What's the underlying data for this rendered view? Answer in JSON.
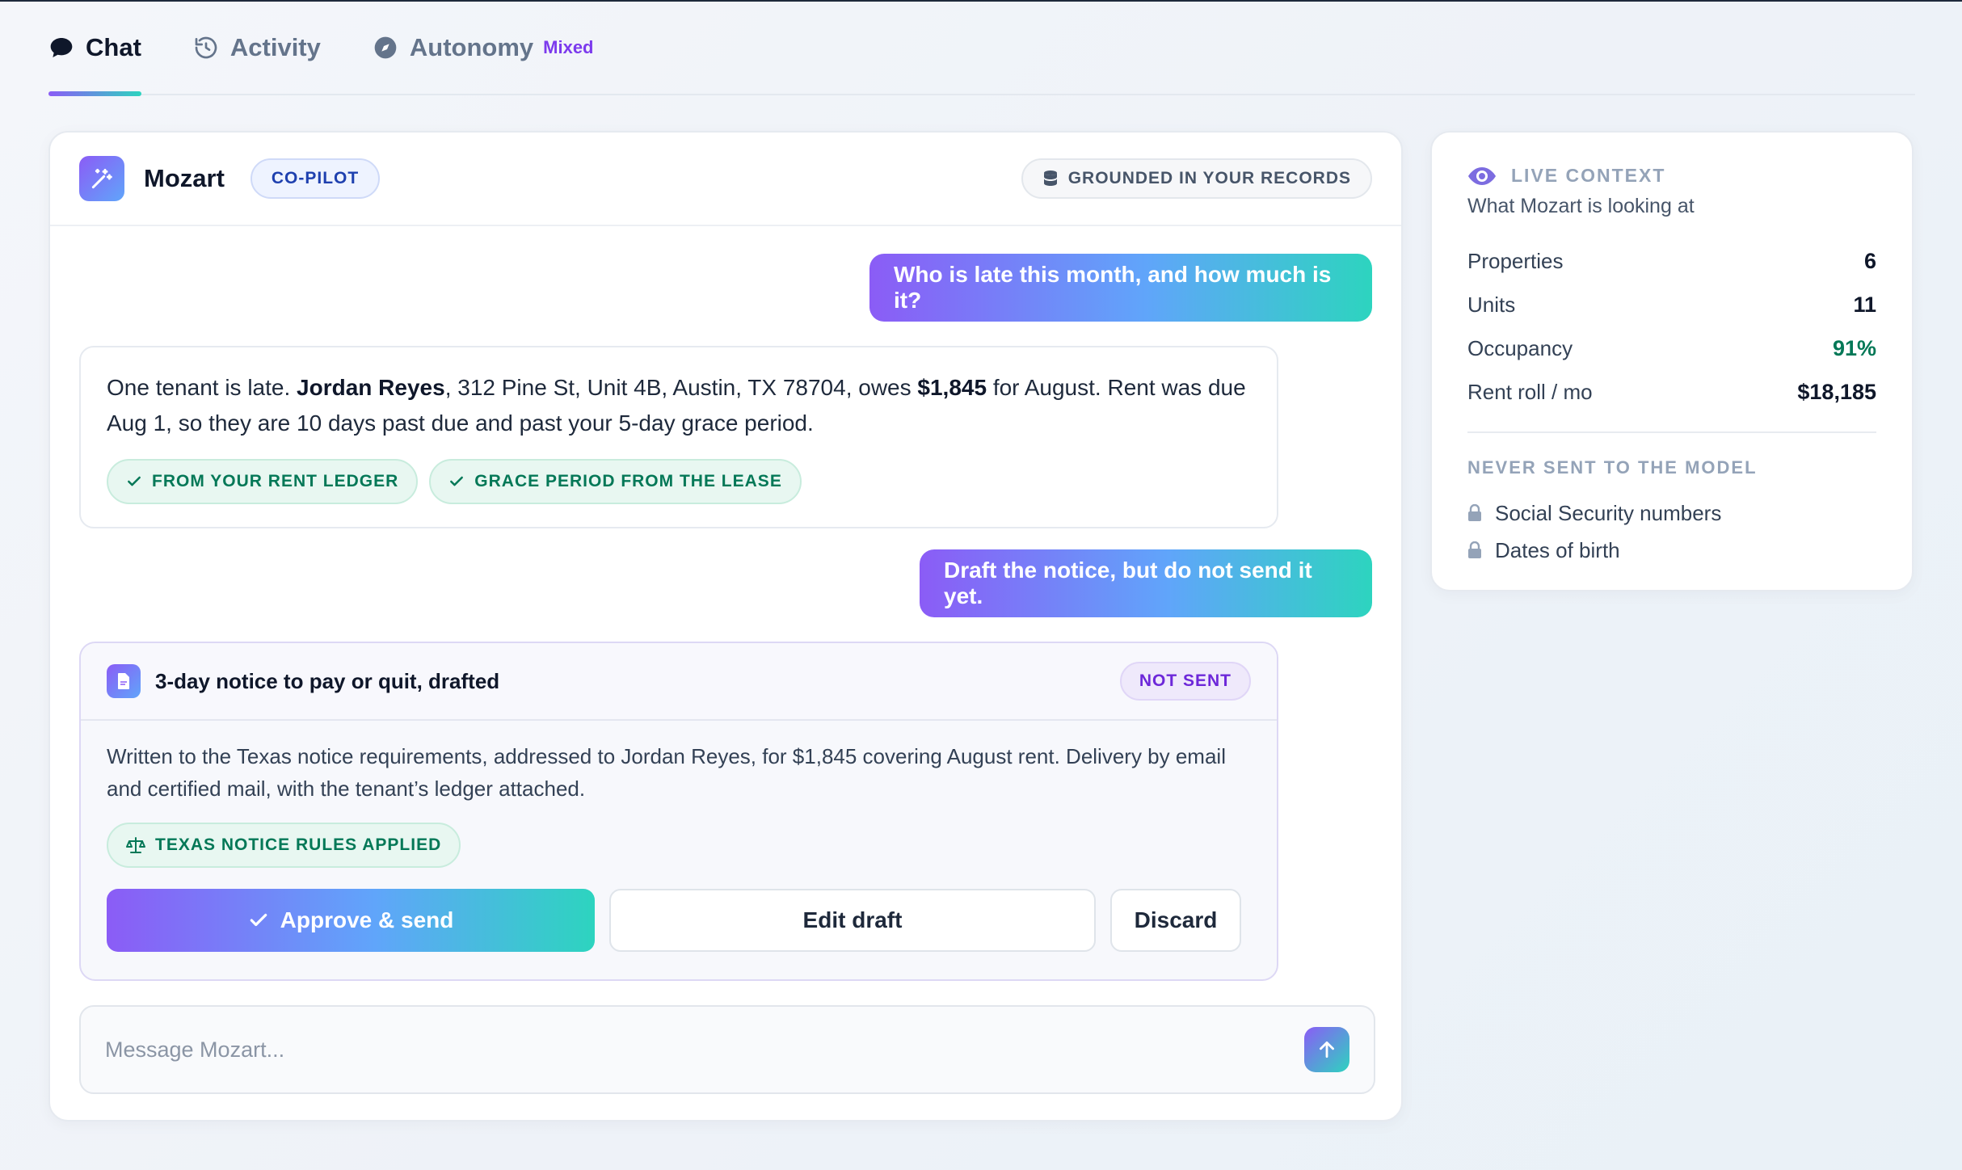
{
  "tabs": [
    {
      "label": "Chat",
      "icon": "chat-bubble-icon"
    },
    {
      "label": "Activity",
      "icon": "history-icon"
    },
    {
      "label": "Autonomy",
      "icon": "compass-icon",
      "badge": "Mixed"
    }
  ],
  "chat": {
    "assistant_name": "Mozart",
    "mode_badge": "CO-PILOT",
    "grounded_badge": "GROUNDED IN YOUR RECORDS",
    "messages": {
      "user_1": "Who is late this month, and how much is it?",
      "answer": {
        "part_1": "One tenant is late. ",
        "tenant": "Jordan Reyes",
        "part_2": ", 312 Pine St, Unit 4B, Austin, TX 78704, owes ",
        "amount": "$1,845",
        "part_3": " for August. Rent was due Aug 1, so they are 10 days past due and past your 5-day grace period.",
        "sources": [
          "FROM YOUR RENT LEDGER",
          "GRACE PERIOD FROM THE LEASE"
        ]
      },
      "user_2": "Draft the notice, but do not send it yet."
    },
    "draft": {
      "title": "3-day notice to pay or quit, drafted",
      "status": "NOT SENT",
      "body": "Written to the Texas notice requirements, addressed to Jordan Reyes, for $1,845 covering August rent. Delivery by email and certified mail, with the tenant’s ledger attached.",
      "rules_chip": "TEXAS NOTICE RULES APPLIED",
      "approve_label": "Approve & send",
      "edit_label": "Edit draft",
      "discard_label": "Discard"
    },
    "composer": {
      "placeholder": "Message Mozart..."
    }
  },
  "live_context": {
    "title": "LIVE CONTEXT",
    "subtitle": "What Mozart is looking at",
    "stats": [
      {
        "label": "Properties",
        "value": "6"
      },
      {
        "label": "Units",
        "value": "11"
      },
      {
        "label": "Occupancy",
        "value": "91%"
      },
      {
        "label": "Rent roll / mo",
        "value": "$18,185"
      }
    ],
    "never_sent_title": "NEVER SENT TO THE MODEL",
    "never_sent": [
      "Social Security numbers",
      "Dates of birth"
    ]
  },
  "colors": {
    "accent_purple": "#8b5cf6",
    "accent_teal": "#2dd4bf",
    "success_green": "#047857",
    "not_sent_purple": "#6d28d9"
  }
}
